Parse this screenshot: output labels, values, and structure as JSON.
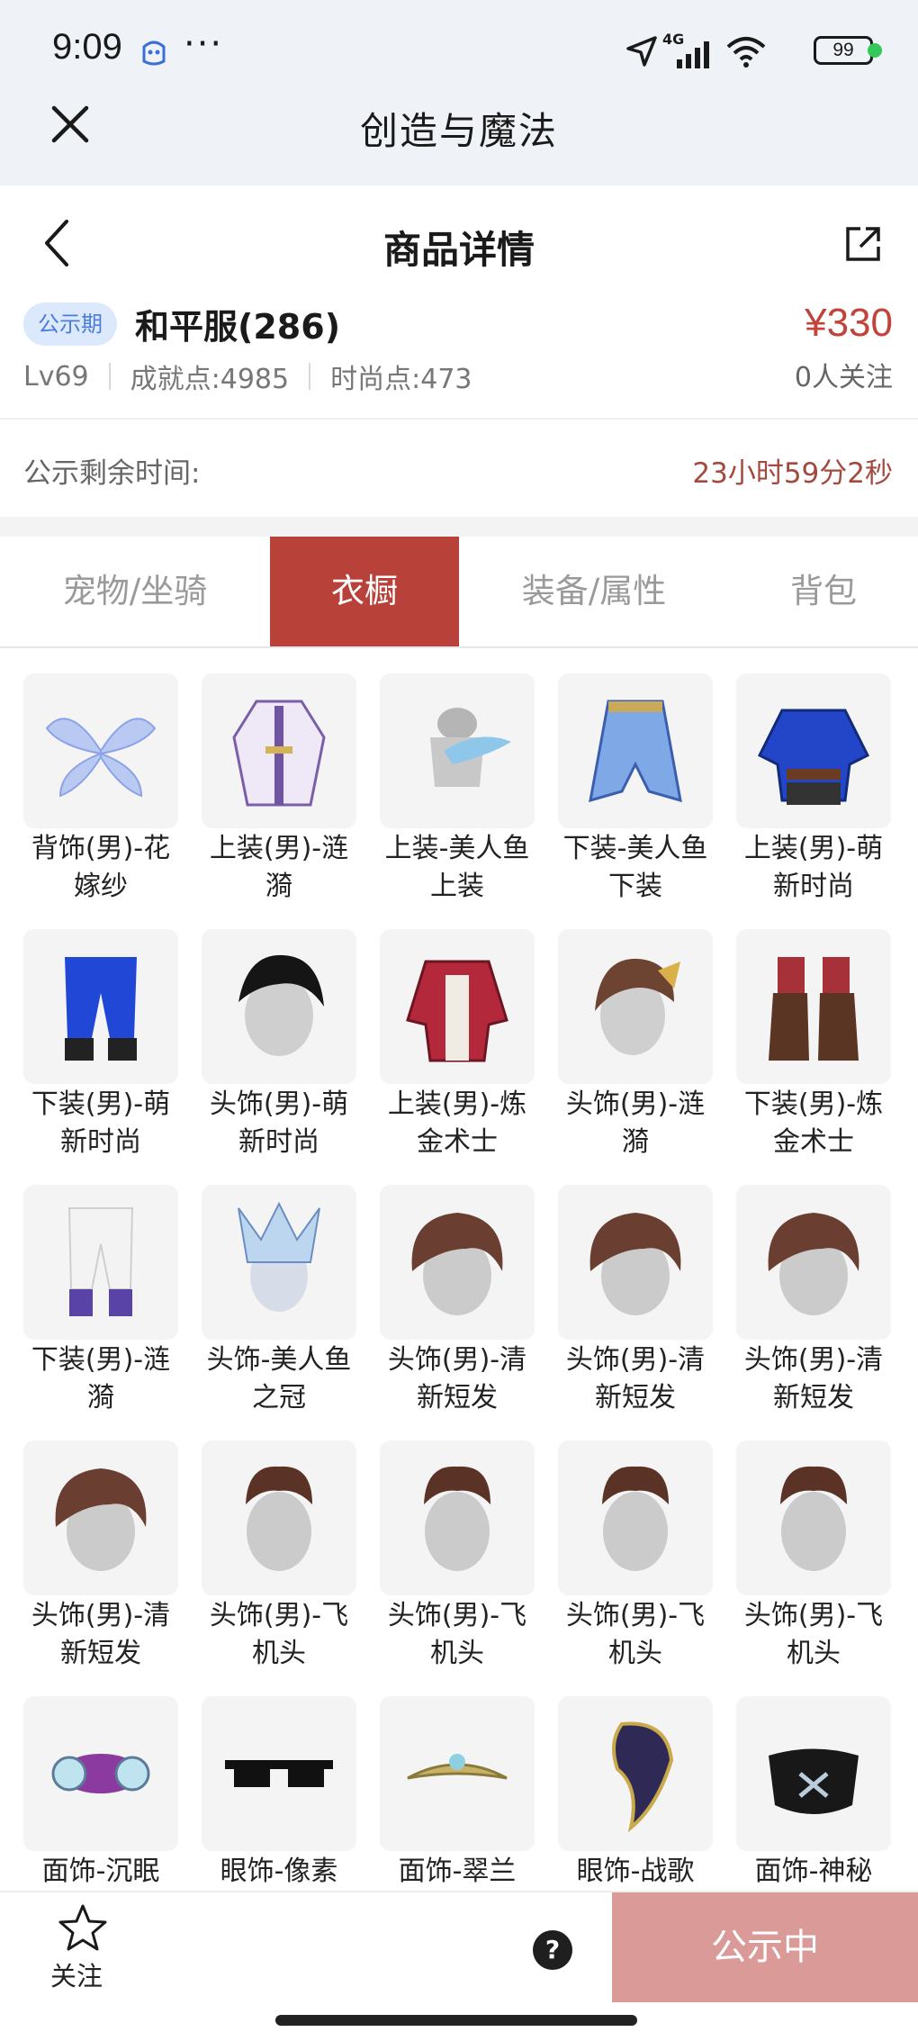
{
  "status_bar": {
    "time": "9:09",
    "dots": "···",
    "network": "4G",
    "battery": "99",
    "icons": [
      "baidu-icon",
      "location-arrow-icon",
      "signal-icon",
      "wifi-icon",
      "battery-icon"
    ]
  },
  "app_header": {
    "title": "创造与魔法",
    "close_icon": "close-icon"
  },
  "page_header": {
    "title": "商品详情",
    "back_icon": "chevron-left-icon",
    "share_icon": "share-icon"
  },
  "product": {
    "badge": "公示期",
    "server": "和平服(286)",
    "price": "¥330",
    "level": "Lv69",
    "achievement": "成就点:4985",
    "fashion": "时尚点:473",
    "followers": "0人关注"
  },
  "countdown": {
    "label": "公示剩余时间:",
    "value": "23小时59分2秒"
  },
  "tabs": [
    {
      "label": "宠物/坐骑",
      "active": false
    },
    {
      "label": "衣橱",
      "active": true
    },
    {
      "label": "装备/属性",
      "active": false
    },
    {
      "label": "背包",
      "active": false
    }
  ],
  "items": [
    {
      "label": "背饰(男)-花嫁纱",
      "icon": "wings"
    },
    {
      "label": "上装(男)-涟漪",
      "icon": "robe"
    },
    {
      "label": "上装-美人鱼上装",
      "icon": "mermaid-top"
    },
    {
      "label": "下装-美人鱼下装",
      "icon": "mermaid-bottom"
    },
    {
      "label": "上装(男)-萌新时尚",
      "icon": "blue-coat"
    },
    {
      "label": "下装(男)-萌新时尚",
      "icon": "blue-pants"
    },
    {
      "label": "头饰(男)-萌新时尚",
      "icon": "black-hair"
    },
    {
      "label": "上装(男)-炼金术士",
      "icon": "red-coat"
    },
    {
      "label": "头饰(男)-涟漪",
      "icon": "brown-hair-gold"
    },
    {
      "label": "下装(男)-炼金术士",
      "icon": "boots"
    },
    {
      "label": "下装(男)-涟漪",
      "icon": "white-pants"
    },
    {
      "label": "头饰-美人鱼之冠",
      "icon": "crown-head"
    },
    {
      "label": "头饰(男)-清新短发",
      "icon": "brown-hair"
    },
    {
      "label": "头饰(男)-清新短发",
      "icon": "brown-hair"
    },
    {
      "label": "头饰(男)-清新短发",
      "icon": "brown-hair"
    },
    {
      "label": "头饰(男)-清新短发",
      "icon": "brown-hair"
    },
    {
      "label": "头饰(男)-飞机头",
      "icon": "pompadour"
    },
    {
      "label": "头饰(男)-飞机头",
      "icon": "pompadour"
    },
    {
      "label": "头饰(男)-飞机头",
      "icon": "pompadour"
    },
    {
      "label": "头饰(男)-飞机头",
      "icon": "pompadour"
    },
    {
      "label": "面饰-沉眠",
      "icon": "sleep-mask"
    },
    {
      "label": "眼饰-像素",
      "icon": "pixel-glasses"
    },
    {
      "label": "面饰-翠兰",
      "icon": "tiara"
    },
    {
      "label": "眼饰-战歌",
      "icon": "war-mask"
    },
    {
      "label": "面饰-神秘",
      "icon": "face-mask"
    }
  ],
  "bottom": {
    "follow": "关注",
    "help": "?",
    "cta": "公示中"
  },
  "colors": {
    "accent": "#b8423a",
    "price": "#c1433a",
    "badge_bg": "#dce8fb",
    "cta_bg": "#d99a98"
  }
}
